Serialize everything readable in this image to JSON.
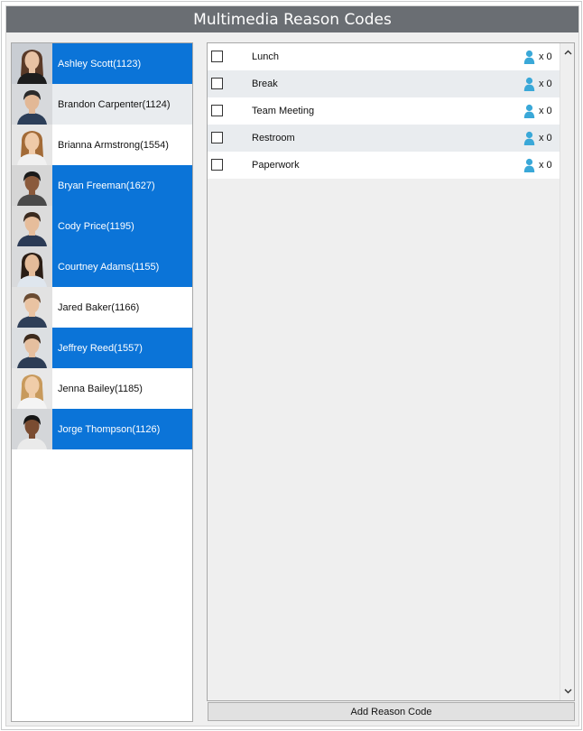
{
  "window": {
    "title": "Multimedia Reason Codes"
  },
  "agents": [
    {
      "name": "Ashley Scott(1123)",
      "state": "selected"
    },
    {
      "name": "Brandon Carpenter(1124)",
      "state": "hover"
    },
    {
      "name": "Brianna Armstrong(1554)",
      "state": "normal"
    },
    {
      "name": "Bryan Freeman(1627)",
      "state": "selected"
    },
    {
      "name": "Cody Price(1195)",
      "state": "selected"
    },
    {
      "name": "Courtney Adams(1155)",
      "state": "selected"
    },
    {
      "name": "Jared Baker(1166)",
      "state": "normal"
    },
    {
      "name": "Jeffrey Reed(1557)",
      "state": "selected"
    },
    {
      "name": "Jenna Bailey(1185)",
      "state": "normal"
    },
    {
      "name": "Jorge Thompson(1126)",
      "state": "selected"
    }
  ],
  "reason_codes": [
    {
      "label": "Lunch",
      "count": "x 0",
      "checked": false
    },
    {
      "label": "Break",
      "count": "x 0",
      "checked": false
    },
    {
      "label": "Team Meeting",
      "count": "x 0",
      "checked": false
    },
    {
      "label": "Restroom",
      "count": "x 0",
      "checked": false
    },
    {
      "label": "Paperwork",
      "count": "x 0",
      "checked": false
    }
  ],
  "actions": {
    "add_reason_code_label": "Add Reason Code"
  },
  "colors": {
    "title_bar": "#6a6e73",
    "selected_row": "#0b74d8",
    "hover_row": "#e9ecef",
    "person_icon": "#3aa8d8"
  },
  "icons": {
    "agent_avatar": "avatar-photo",
    "agent_count": "person-icon",
    "scroll_up": "chevron-up-icon",
    "scroll_down": "chevron-down-icon"
  }
}
